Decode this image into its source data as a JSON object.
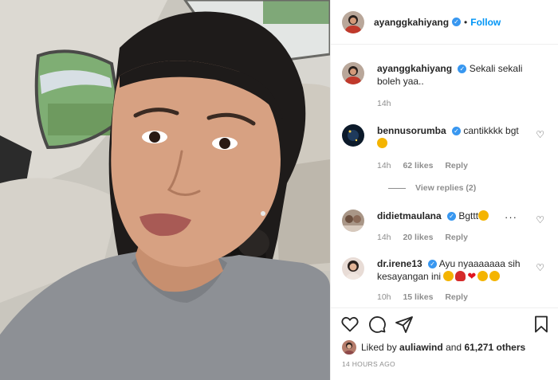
{
  "header": {
    "username": "ayanggkahiyang",
    "dot": "•",
    "follow_label": "Follow"
  },
  "caption": {
    "username": "ayanggkahiyang",
    "text": "Sekali sekali boleh yaa..",
    "time": "14h"
  },
  "comments": [
    {
      "username": "bennusorumba",
      "text": "cantikkkk bgt",
      "time": "14h",
      "likes": "62 likes",
      "reply": "Reply",
      "view_replies": "View replies (2)"
    },
    {
      "username": "didietmaulana",
      "text": "Bgttt",
      "time": "14h",
      "likes": "20 likes",
      "reply": "Reply"
    },
    {
      "username": "dr.irene13",
      "text": "Ayu nyaaaaaaa sih kesayangan ini",
      "time": "10h",
      "likes": "15 likes",
      "reply": "Reply"
    }
  ],
  "footer": {
    "liked_by_prefix": "Liked by",
    "liked_by_user": "auliawind",
    "liked_by_and": "and",
    "liked_by_count": "61,271 others",
    "timestamp": "14 HOURS AGO"
  },
  "icons": {
    "like": "heart-icon",
    "comment": "comment-icon",
    "share": "share-icon",
    "save": "bookmark-icon",
    "more": "more-options-icon",
    "verified": "verified-badge-icon"
  },
  "colors": {
    "link_blue": "#0095f6",
    "verified_blue": "#3897f0",
    "muted": "#8e8e8e",
    "text": "#262626"
  }
}
